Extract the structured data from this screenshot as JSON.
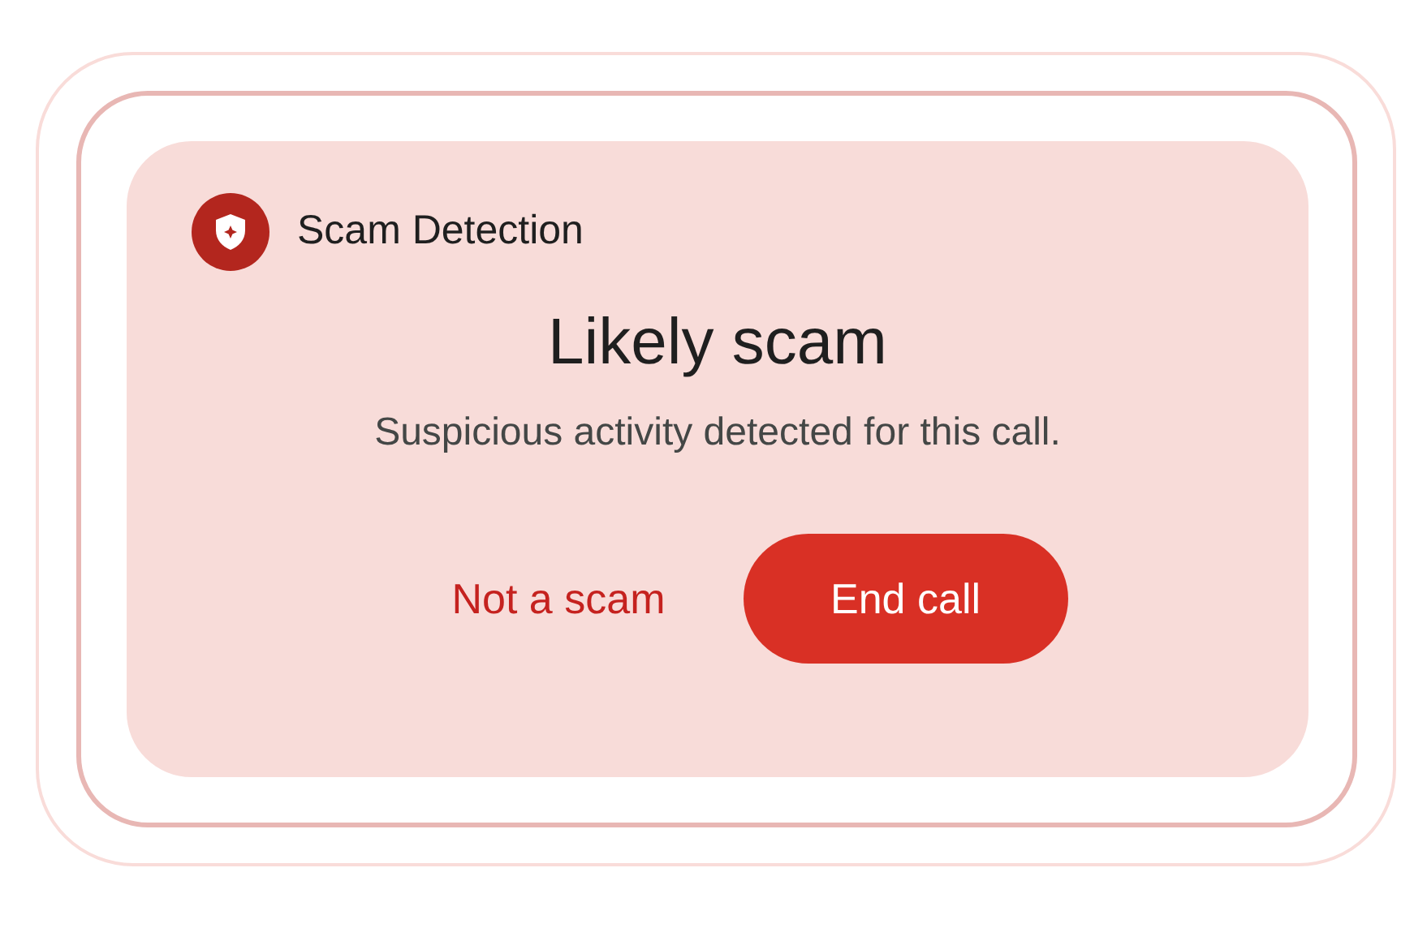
{
  "header": {
    "title": "Scam Detection"
  },
  "heading": "Likely scam",
  "message": "Suspicious activity detected for this call.",
  "buttons": [
    {
      "label": "Not a scam",
      "kind": "text"
    },
    {
      "label": "End call",
      "kind": "filled"
    }
  ]
}
